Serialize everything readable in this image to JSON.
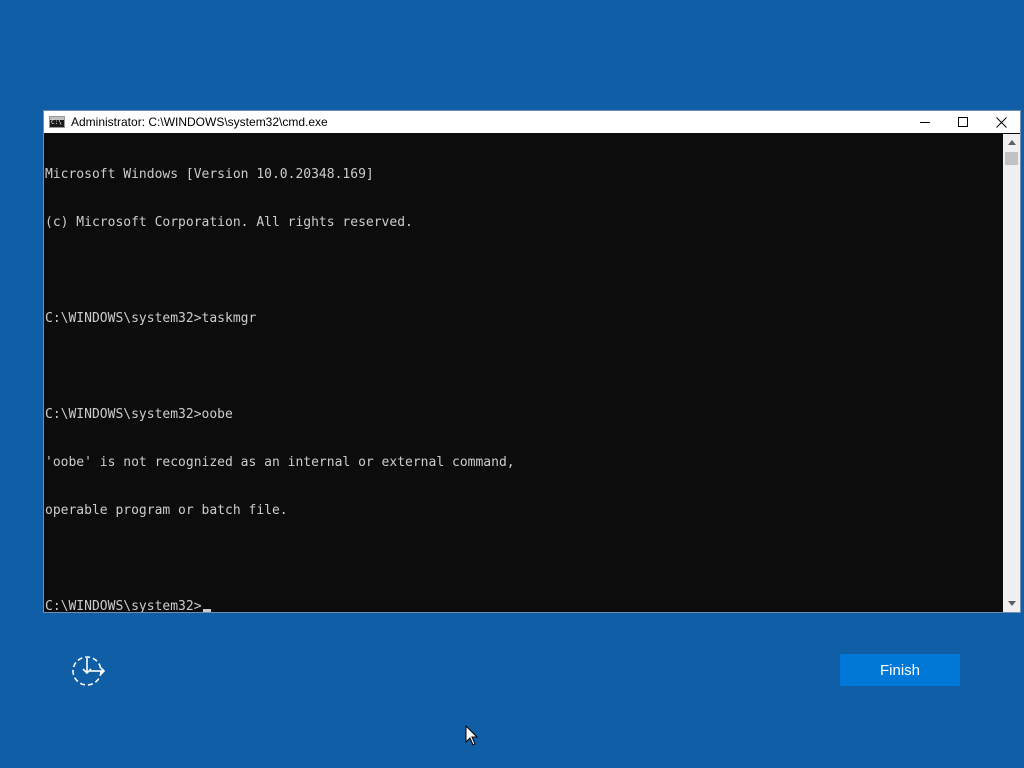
{
  "window": {
    "title": "Administrator: C:\\WINDOWS\\system32\\cmd.exe",
    "icon": "cmd-icon",
    "controls": [
      "minimize-icon",
      "maximize-icon",
      "close-icon"
    ]
  },
  "console": {
    "lines": [
      "Microsoft Windows [Version 10.0.20348.169]",
      "(c) Microsoft Corporation. All rights reserved.",
      "",
      "C:\\WINDOWS\\system32>taskmgr",
      "",
      "C:\\WINDOWS\\system32>oobe",
      "'oobe' is not recognized as an internal or external command,",
      "operable program or batch file.",
      ""
    ],
    "prompt": "C:\\WINDOWS\\system32>",
    "text_color": "#cccccc",
    "background_color": "#0c0c0c"
  },
  "oobe": {
    "accessibility_icon": "ease-of-access-icon",
    "finish_label": "Finish",
    "finish_color": "#0078d7",
    "background_color": "#0f5ea6"
  }
}
